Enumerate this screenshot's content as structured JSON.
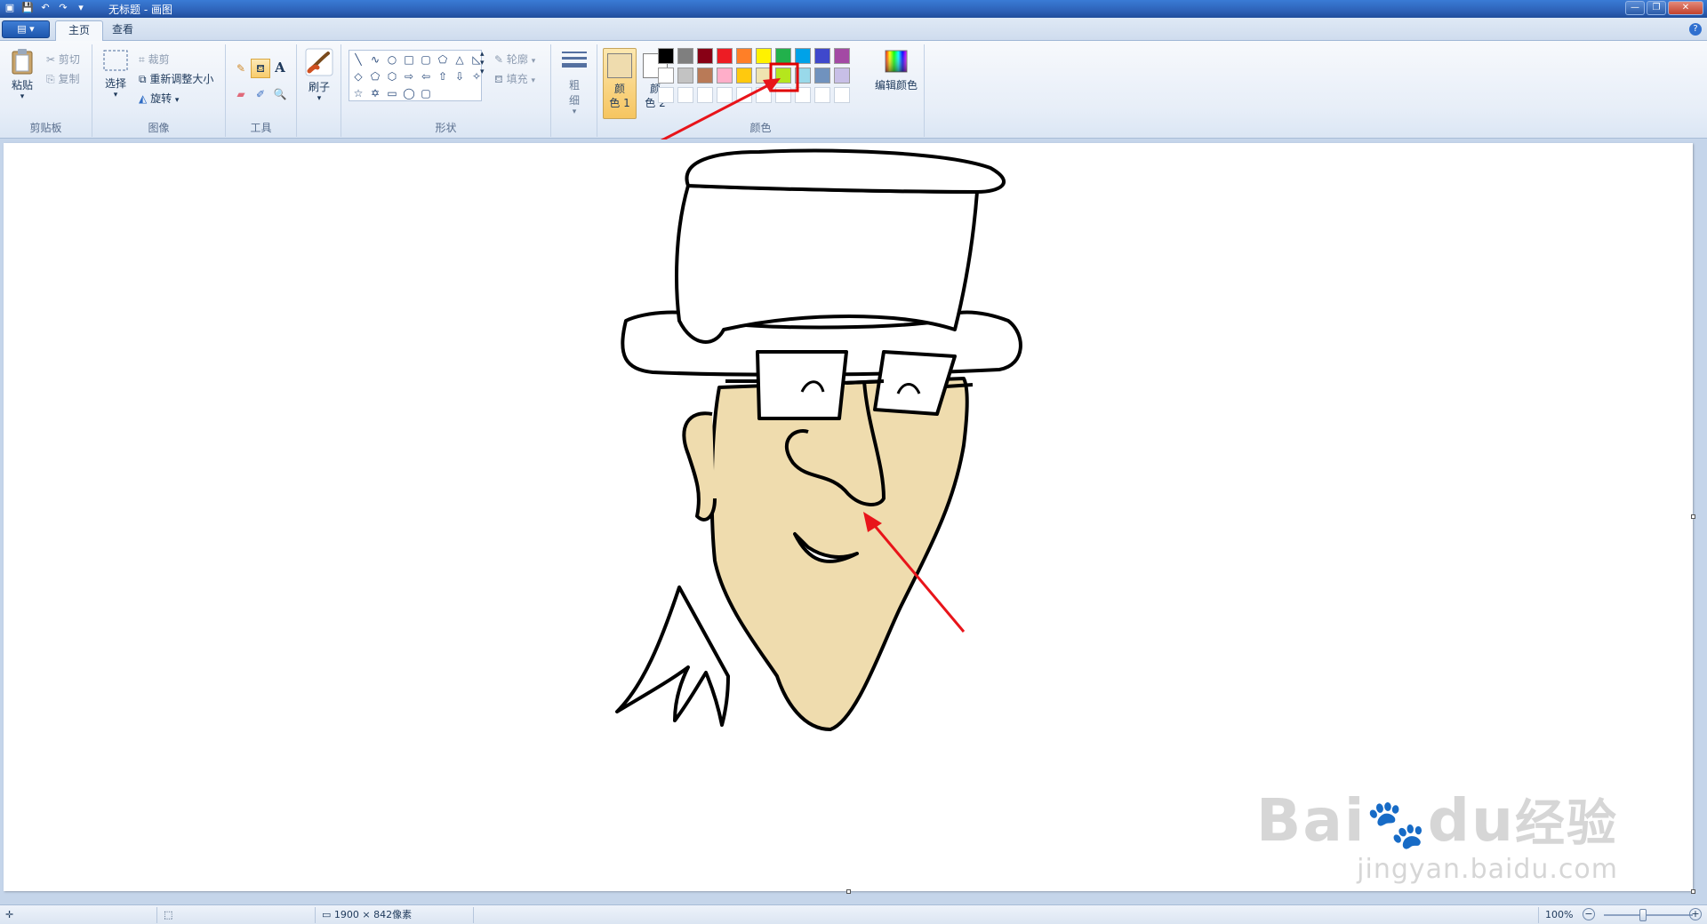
{
  "window": {
    "title": "无标题 - 画图"
  },
  "tabs": [
    {
      "label": "主页",
      "active": true
    },
    {
      "label": "查看",
      "active": false
    }
  ],
  "ribbon": {
    "clipboard": {
      "group_label": "剪贴板",
      "paste": "粘贴",
      "cut": "剪切",
      "copy": "复制"
    },
    "image": {
      "group_label": "图像",
      "select": "选择",
      "crop": "裁剪",
      "resize": "重新调整大小",
      "rotate": "旋转"
    },
    "tools": {
      "group_label": "工具",
      "icons": [
        "pencil-icon",
        "fill-bucket-icon",
        "text-icon",
        "eraser-icon",
        "color-picker-icon",
        "magnifier-icon"
      ],
      "text_glyph": "A"
    },
    "brushes": {
      "label": "刷子"
    },
    "shapes": {
      "group_label": "形状",
      "outline": "轮廓",
      "fill": "填充",
      "glyphs": [
        "╲",
        "∿",
        "○",
        "□",
        "▢",
        "⬠",
        "△",
        "◺",
        "◇",
        "⬠",
        "⬡",
        "⇨",
        "⇦",
        "⇧",
        "⇩",
        "✧",
        "☆",
        "✡",
        "▭",
        "◯",
        "▢",
        "",
        "",
        ""
      ]
    },
    "size": {
      "label_top": "粗",
      "label_bottom": "细"
    },
    "colors": {
      "group_label": "颜色",
      "color1_label_a": "颜",
      "color1_label_b": "色 1",
      "color2_label_a": "颜",
      "color2_label_b": "色 2",
      "color1": "#efdcae",
      "color2": "#ffffff",
      "edit_colors": "编辑颜色",
      "palette": [
        "#000000",
        "#7f7f7f",
        "#880015",
        "#ed1c24",
        "#ff7f27",
        "#fff200",
        "#22b14c",
        "#00a2e8",
        "#3f48cc",
        "#a349a4",
        "#ffffff",
        "#c3c3c3",
        "#b97a57",
        "#ffaec9",
        "#ffc90e",
        "#efe4b0",
        "#b5e61d",
        "#99d9ea",
        "#7092be",
        "#c8bfe7",
        "",
        "",
        "",
        "",
        "",
        "",
        "",
        "",
        "",
        ""
      ],
      "highlighted_index": 15
    }
  },
  "status": {
    "canvas_size": "1900 × 842像素",
    "zoom": "100%"
  },
  "watermark": {
    "brand": "Bai",
    "brand2": "du",
    "cn": "经验",
    "url": "jingyan.baidu.com"
  }
}
